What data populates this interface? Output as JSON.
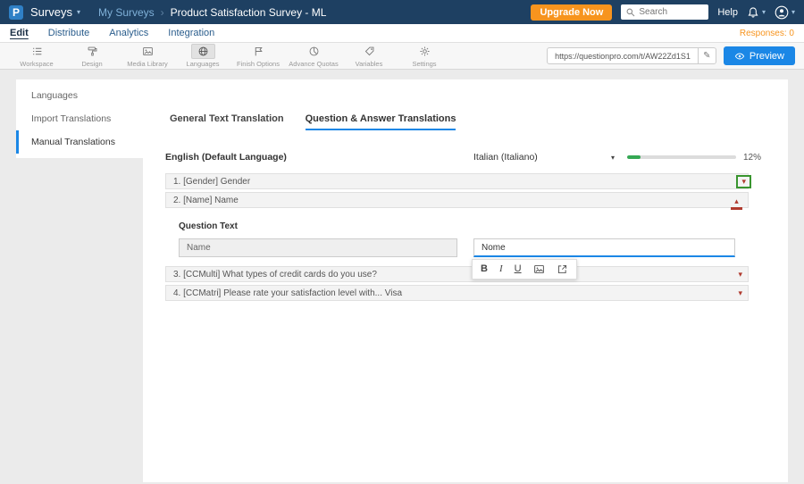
{
  "colors": {
    "topbar-bg": "#1e4062",
    "accent": "#1b87e6",
    "orange": "#f7941e",
    "progress-green": "#35a854",
    "caret-red": "#b03a2e",
    "focus-green": "#39952f"
  },
  "topbar": {
    "logo_text": "P",
    "app_menu": "Surveys",
    "breadcrumb": {
      "parent": "My Surveys",
      "current": "Product Satisfaction Survey - ML"
    },
    "upgrade_button": "Upgrade Now",
    "search_placeholder": "Search",
    "help_label": "Help"
  },
  "nav": {
    "tabs": [
      {
        "label": "Edit"
      },
      {
        "label": "Distribute"
      },
      {
        "label": "Analytics"
      },
      {
        "label": "Integration"
      }
    ],
    "responses": "Responses: 0"
  },
  "ribbon": {
    "items": [
      {
        "label": "Workspace"
      },
      {
        "label": "Design"
      },
      {
        "label": "Media Library"
      },
      {
        "label": "Languages"
      },
      {
        "label": "Finish Options"
      },
      {
        "label": "Advance Quotas"
      },
      {
        "label": "Variables"
      },
      {
        "label": "Settings"
      }
    ],
    "survey_url": "https://questionpro.com/t/AW22Zd1S1",
    "preview_button": "Preview"
  },
  "sidebar": {
    "items": [
      {
        "label": "Languages"
      },
      {
        "label": "Import Translations"
      },
      {
        "label": "Manual Translations"
      }
    ]
  },
  "translation": {
    "tabs": [
      {
        "label": "General Text Translation"
      },
      {
        "label": "Question & Answer Translations"
      }
    ],
    "source_language": "English (Default Language)",
    "target_language": "Italian (Italiano)",
    "progress_percent": 12,
    "progress_label": "12%",
    "questions": [
      {
        "title": "1. [Gender] Gender"
      },
      {
        "title": "2. [Name] Name"
      },
      {
        "title": "3. [CCMulti] What types of credit cards do you use?"
      },
      {
        "title": "4. [CCMatri] Please rate your satisfaction level with... Visa"
      }
    ],
    "editor": {
      "field_label": "Question Text",
      "source_text": "Name",
      "target_text": "Nome",
      "format_buttons": {
        "bold": "B",
        "italic": "I",
        "underline": "U"
      }
    }
  }
}
